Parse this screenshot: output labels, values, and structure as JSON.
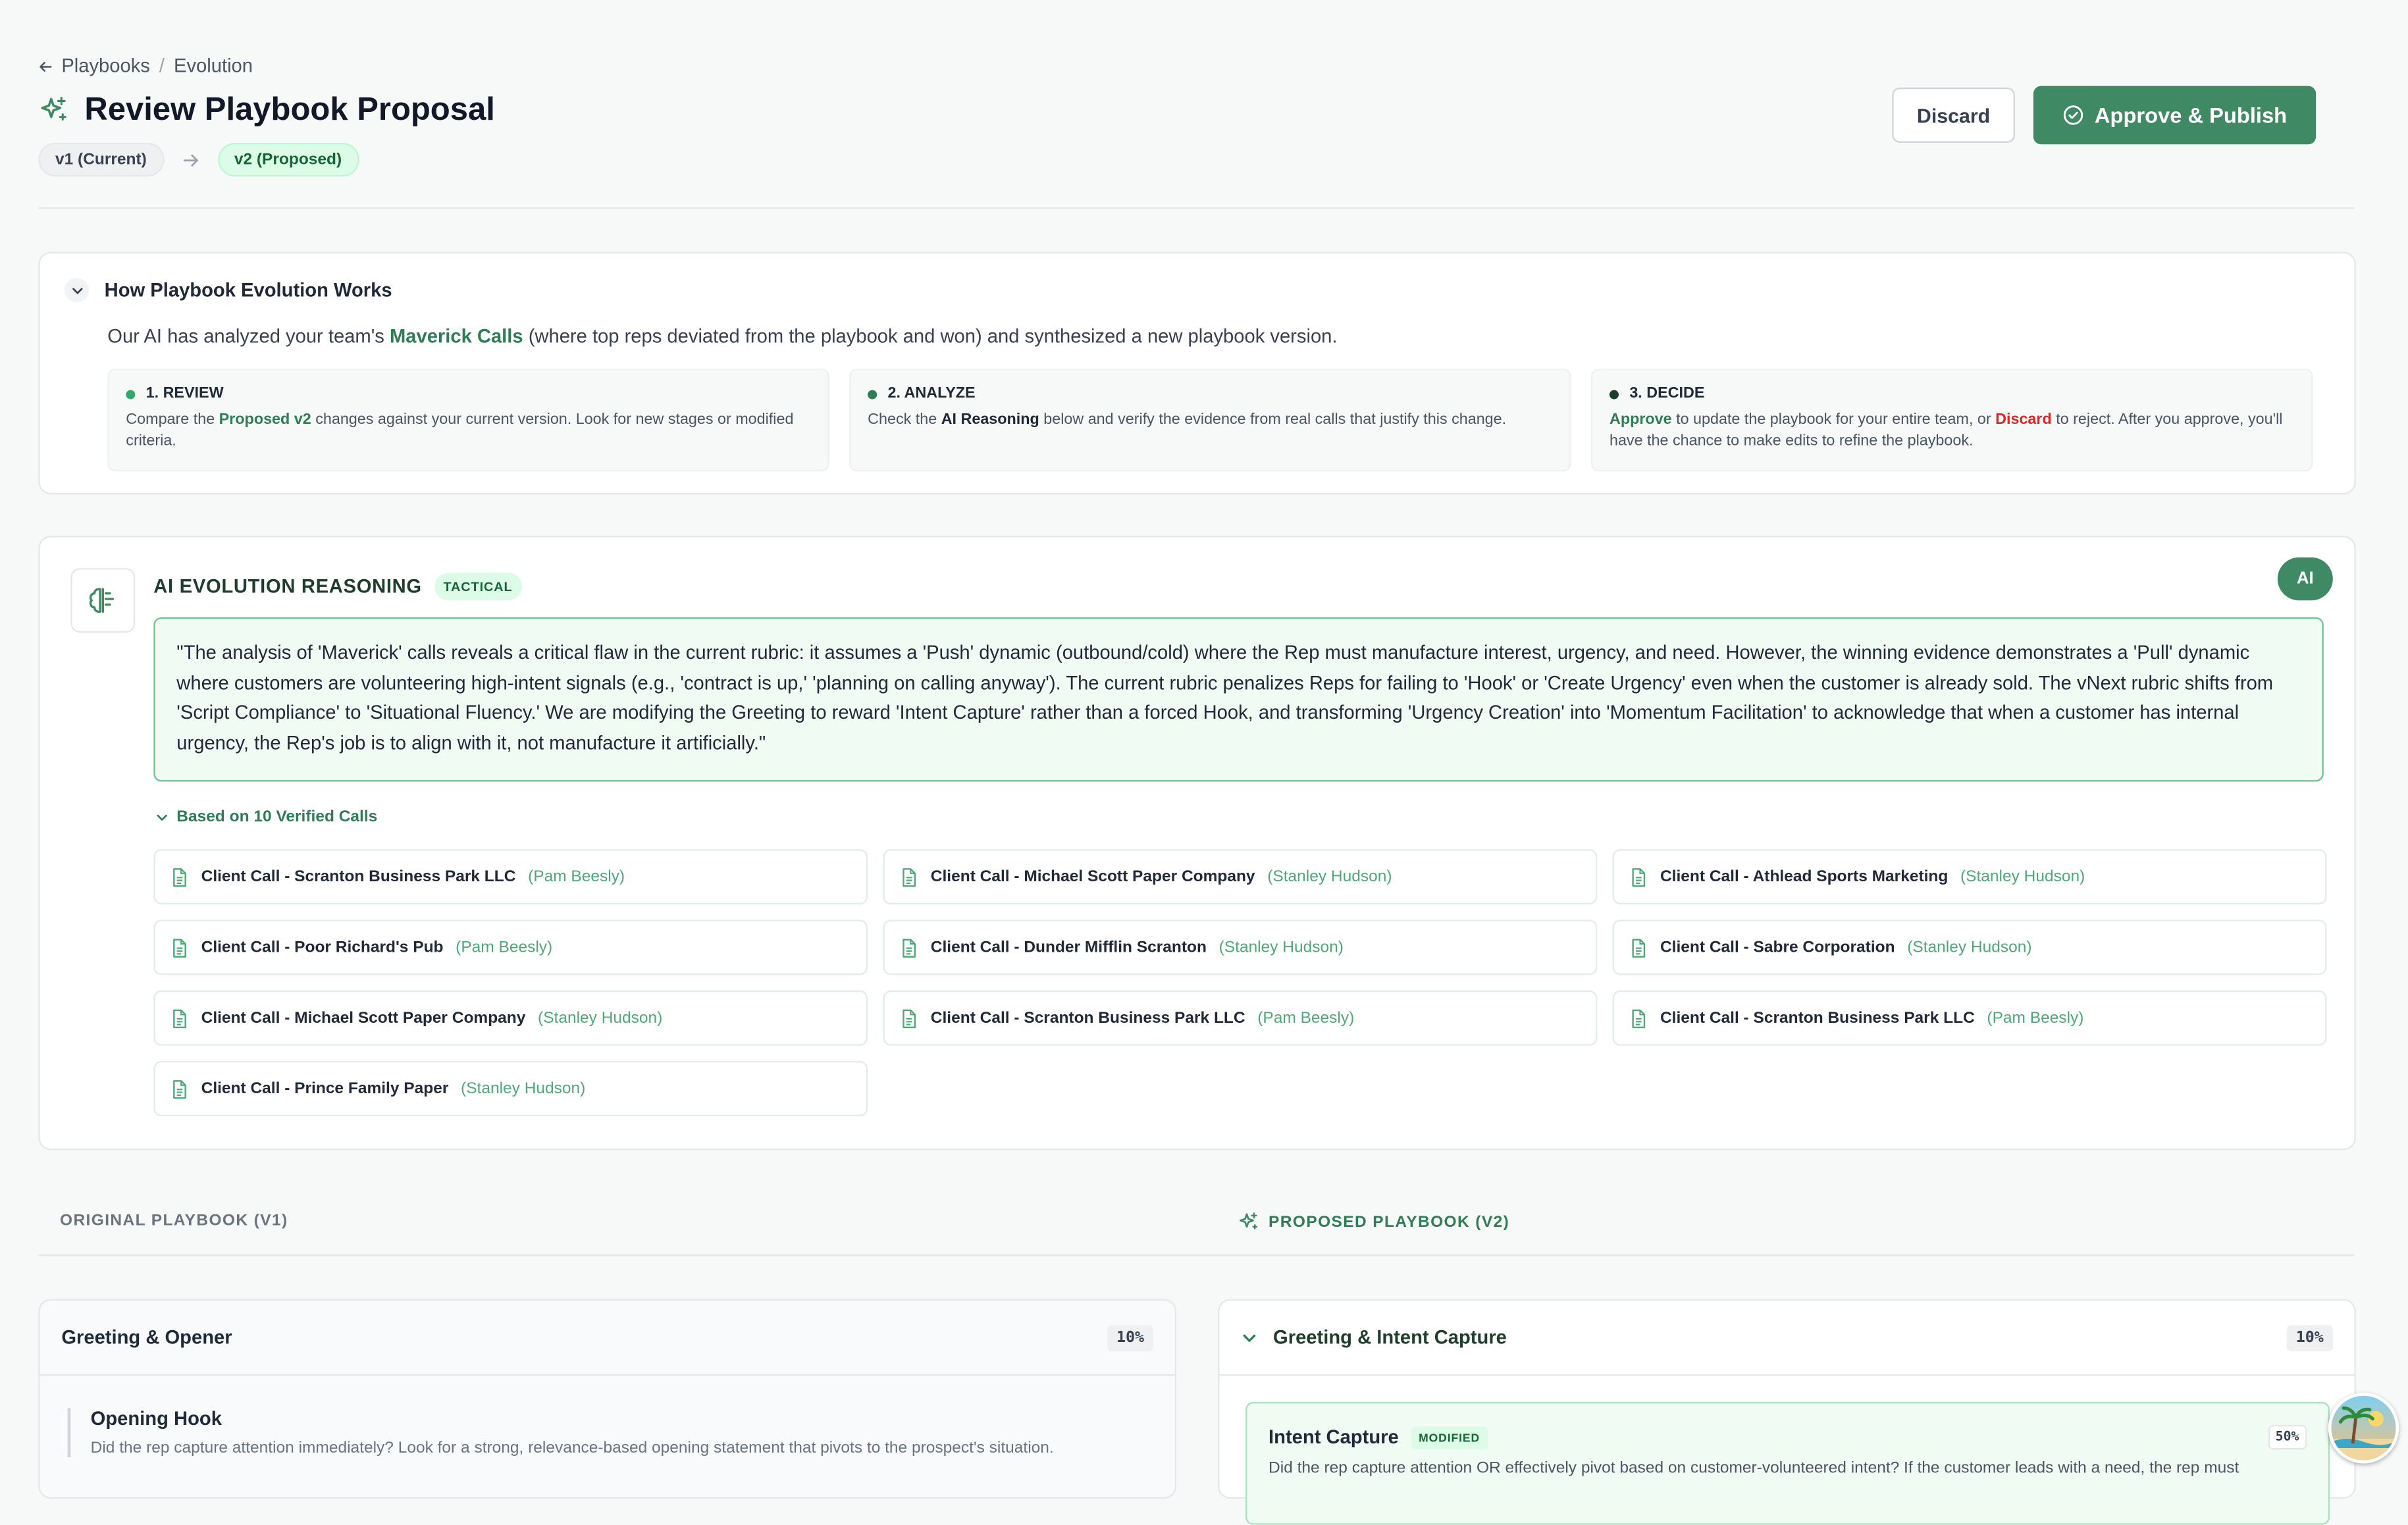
{
  "breadcrumb": {
    "root": "Playbooks",
    "separator": "/",
    "current": "Evolution"
  },
  "page": {
    "title": "Review Playbook Proposal"
  },
  "versions": {
    "current": "v1 (Current)",
    "proposed": "v2 (Proposed)"
  },
  "actions": {
    "discard": "Discard",
    "approve": "Approve & Publish"
  },
  "how": {
    "title": "How Playbook Evolution Works",
    "desc_pre": "Our AI has analyzed your team's ",
    "desc_highlight": "Maverick Calls",
    "desc_post": " (where top reps deviated from the playbook and won) and synthesized a new playbook version.",
    "steps": [
      {
        "title": "1. REVIEW",
        "color": "#34a86a",
        "t1": "Compare the ",
        "b1": "Proposed v2",
        "t2": " changes against your current version. Look for new stages or modified criteria."
      },
      {
        "title": "2. ANALYZE",
        "color": "#2f7d55",
        "t1": "Check the ",
        "b1": "AI Reasoning",
        "t2": " below and verify the evidence from real calls that justify this change."
      },
      {
        "title": "3. DECIDE",
        "color": "#1f3d2d",
        "b1": "Approve",
        "t1": " to update the playbook for your entire team, or ",
        "b2": "Discard",
        "t2": " to reject. After you approve, you'll have the chance to make edits to refine the playbook."
      }
    ]
  },
  "reasoning": {
    "title": "AI EVOLUTION REASONING",
    "tag": "TACTICAL",
    "badge": "AI",
    "quote": "\"The analysis of 'Maverick' calls reveals a critical flaw in the current rubric: it assumes a 'Push' dynamic (outbound/cold) where the Rep must manufacture interest, urgency, and need. However, the winning evidence demonstrates a 'Pull' dynamic where customers are volunteering high-intent signals (e.g., 'contract is up,' 'planning on calling anyway'). The current rubric penalizes Reps for failing to 'Hook' or 'Create Urgency' even when the customer is already sold. The vNext rubric shifts from 'Script Compliance' to 'Situational Fluency.' We are modifying the Greeting to reward 'Intent Capture' rather than a forced Hook, and transforming 'Urgency Creation' into 'Momentum Facilitation' to acknowledge that when a customer has internal urgency, the Rep's job is to align with it, not manufacture it artificially.\"",
    "based_on": "Based on 10 Verified Calls",
    "calls": [
      {
        "title": "Client Call - Scranton Business Park LLC",
        "person": "(Pam Beesly)"
      },
      {
        "title": "Client Call - Michael Scott Paper Company",
        "person": "(Stanley Hudson)"
      },
      {
        "title": "Client Call - Athlead Sports Marketing",
        "person": "(Stanley Hudson)"
      },
      {
        "title": "Client Call - Poor Richard's Pub",
        "person": "(Pam Beesly)"
      },
      {
        "title": "Client Call - Dunder Mifflin Scranton",
        "person": "(Stanley Hudson)"
      },
      {
        "title": "Client Call - Sabre Corporation",
        "person": "(Stanley Hudson)"
      },
      {
        "title": "Client Call - Michael Scott Paper Company",
        "person": "(Stanley Hudson)"
      },
      {
        "title": "Client Call - Scranton Business Park LLC",
        "person": "(Pam Beesly)"
      },
      {
        "title": "Client Call - Scranton Business Park LLC",
        "person": "(Pam Beesly)"
      },
      {
        "title": "Client Call - Prince Family Paper",
        "person": "(Stanley Hudson)"
      }
    ]
  },
  "original": {
    "heading": "ORIGINAL PLAYBOOK (V1)",
    "section": {
      "title": "Greeting & Opener",
      "weight": "10%"
    },
    "criterion": {
      "name": "Opening Hook",
      "desc": "Did the rep capture attention immediately? Look for a strong, relevance-based opening statement that pivots to the prospect's situation."
    }
  },
  "proposed": {
    "heading": "PROPOSED PLAYBOOK (V2)",
    "section": {
      "title": "Greeting & Intent Capture",
      "weight": "10%"
    },
    "criterion": {
      "name": "Intent Capture",
      "tag": "MODIFIED",
      "weight": "50%",
      "desc": "Did the rep capture attention OR effectively pivot based on customer-volunteered intent? If the customer leads with a need, the rep must"
    }
  },
  "colors": {
    "accent": "#3f8a64",
    "accent_light": "#effbf3",
    "danger": "#dc2626"
  }
}
